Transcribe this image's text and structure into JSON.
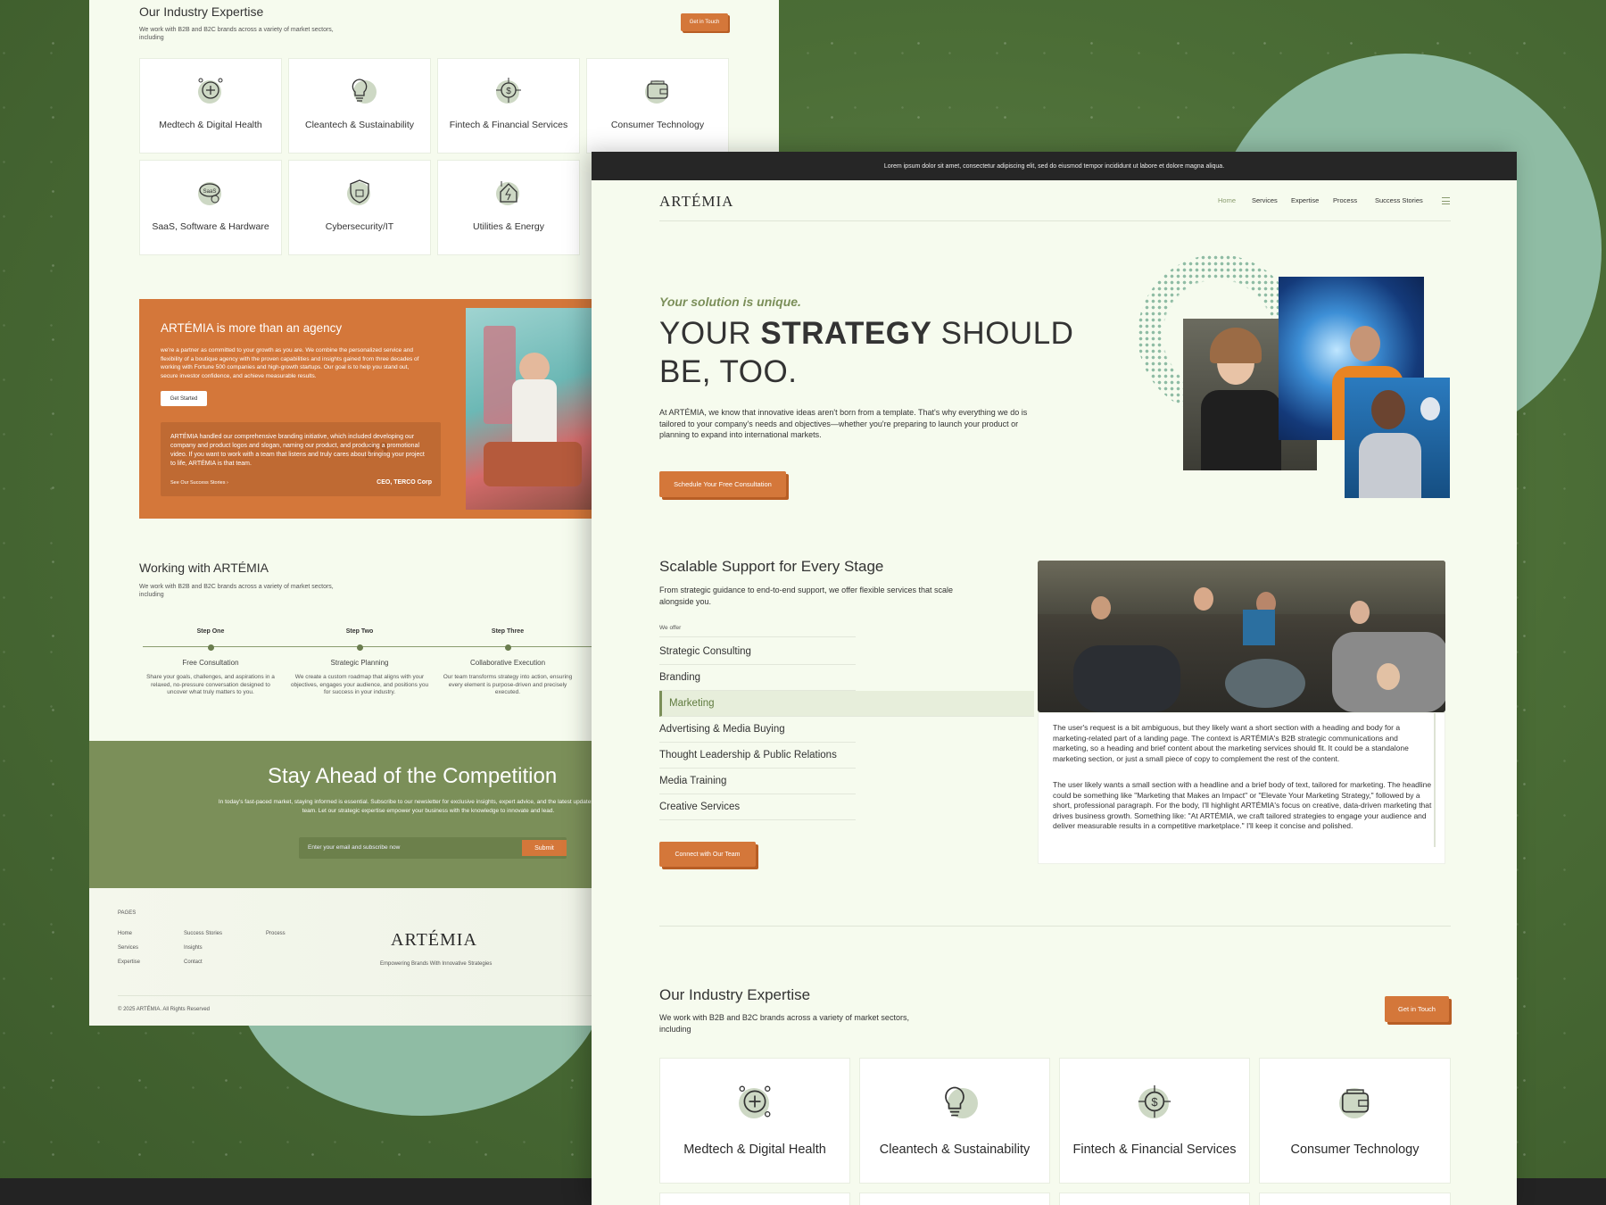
{
  "brand": "ARTÉMIA",
  "back": {
    "expertise": {
      "title": "Our Industry Expertise",
      "subtitle": "We work with B2B and B2C brands across a variety of market sectors, including",
      "cta": "Get in Touch",
      "cards": [
        {
          "label": "Medtech & Digital Health",
          "icon": "medtech-icon"
        },
        {
          "label": "Cleantech & Sustainability",
          "icon": "bulb-icon"
        },
        {
          "label": "Fintech & Financial Services",
          "icon": "fintech-icon"
        },
        {
          "label": "Consumer Technology",
          "icon": "wallet-icon"
        },
        {
          "label": "SaaS, Software & Hardware",
          "icon": "saas-icon"
        },
        {
          "label": "Cybersecurity/IT",
          "icon": "shield-icon"
        },
        {
          "label": "Utilities & Energy",
          "icon": "energy-icon"
        }
      ]
    },
    "promo": {
      "title": "ARTÉMIA is more than an agency",
      "text": "we're a partner as committed to your growth as you are. We combine the personalized service and flexibility of a boutique agency with the proven capabilities and insights gained from three decades of working with Fortune 500 companies and high-growth startups. Our goal is to help you stand out, secure investor confidence, and achieve measurable results.",
      "cta": "Get Started",
      "quote": "ARTÉMIA handled our comprehensive branding initiative, which included developing our company and product logos and slogan, naming our product, and producing a promotional video. If you want to work with a team that listens and truly cares about bringing your project to life, ARTÉMIA is that team.",
      "link": "See Our Success Stories",
      "author": "CEO, TERCO Corp"
    },
    "working": {
      "title": "Working with ARTÉMIA",
      "subtitle": "We work with B2B and B2C brands across a variety of market sectors, including",
      "steps": [
        {
          "n": "Step One",
          "t": "Free Consultation",
          "x": "Share your goals, challenges, and aspirations in a relaxed, no-pressure conversation designed to uncover what truly matters to you."
        },
        {
          "n": "Step Two",
          "t": "Strategic Planning",
          "x": "We create a custom roadmap that aligns with your objectives, engages your audience, and positions you for success in your industry."
        },
        {
          "n": "Step Three",
          "t": "Collaborative Execution",
          "x": "Our team transforms strategy into action, ensuring every element is purpose-driven and precisely executed."
        }
      ]
    },
    "newsletter": {
      "title": "Stay Ahead of the Competition",
      "text": "In today's fast-paced market, staying informed is essential. Subscribe to our newsletter for exclusive insights, expert advice, and the latest updates from ARTÉMIA's team. Let our strategic expertise empower your business with the knowledge to innovate and lead.",
      "placeholder": "Enter your email and subscribe now",
      "button": "Submit"
    },
    "footer": {
      "pages_label": "PAGES",
      "col1": [
        "Home",
        "Services",
        "Expertise"
      ],
      "col2": [
        "Success Stories",
        "Insights",
        "Contact"
      ],
      "col3": [
        "Process"
      ],
      "tagline": "Empowering Brands With Innovative Strategies",
      "copyright": "© 2025 ARTÉMIA. All Rights Reserved"
    }
  },
  "front": {
    "topbar": "Lorem ipsum dolor sit amet, consectetur adipiscing elit, sed do eiusmod tempor incididunt ut labore et dolore magna aliqua.",
    "nav": [
      "Home",
      "Services",
      "Expertise",
      "Process",
      "Success Stories"
    ],
    "hero": {
      "eyebrow": "Your solution is unique.",
      "h1a": "YOUR ",
      "h1b": "STRATEGY",
      "h1c": " SHOULD",
      "h1d": "BE, TOO.",
      "text": "At ARTÉMIA, we know that innovative ideas aren't born from a template. That's why everything we do is tailored to your company's needs and objectives—whether you're preparing to launch your product or planning to expand into international markets.",
      "cta": "Schedule Your Free Consultation"
    },
    "support": {
      "title": "Scalable Support for Every Stage",
      "subtitle": "From strategic guidance to end-to-end support, we offer flexible services that scale alongside you.",
      "we_offer": "We offer",
      "services": [
        "Strategic Consulting",
        "Branding",
        "Marketing",
        "Advertising & Media Buying",
        "Thought Leadership & Public Relations",
        "Media Training",
        "Creative Services"
      ],
      "active": 2,
      "cta": "Connect with Our Team",
      "p1": "The user's request is a bit ambiguous, but they likely want a short section with a heading and body for a marketing-related part of a landing page. The context is ARTÉMIA's B2B strategic communications and marketing, so a heading and brief content about the marketing services should fit. It could be a standalone marketing section, or just a small piece of copy to complement the rest of the content.",
      "p2": "The user likely wants a small section with a headline and a brief body of text, tailored for marketing. The headline could be something like \"Marketing that Makes an Impact\" or \"Elevate Your Marketing Strategy,\" followed by a short, professional paragraph. For the body, I'll highlight ARTÉMIA's focus on creative, data-driven marketing that drives business growth. Something like: \"At ARTÉMIA, we craft tailored strategies to engage your audience and deliver measurable results in a competitive marketplace.\" I'll keep it concise and polished."
    },
    "expertise": {
      "title": "Our Industry Expertise",
      "subtitle": "We work with B2B and B2C brands across a variety of market sectors, including",
      "cta": "Get in Touch",
      "cards": [
        "Medtech & Digital Health",
        "Cleantech & Sustainability",
        "Fintech & Financial Services",
        "Consumer Technology"
      ]
    }
  }
}
